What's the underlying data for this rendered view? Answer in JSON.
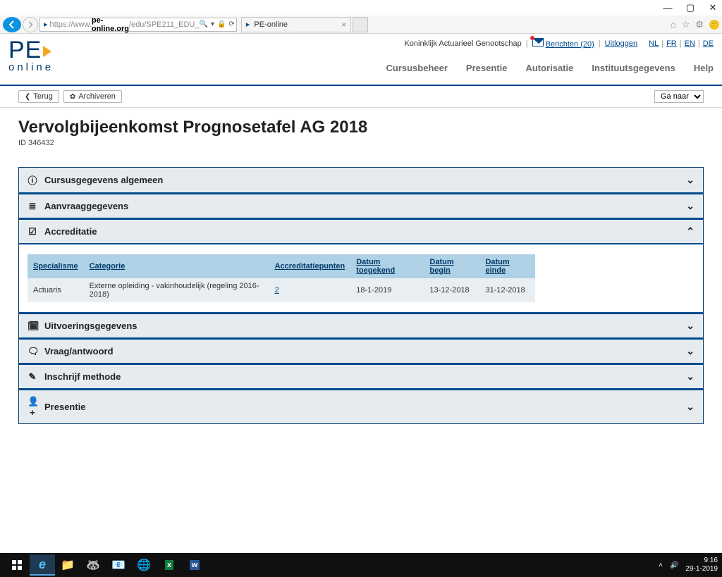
{
  "browser": {
    "url_prefix": "https://",
    "url_pre2": "www.",
    "host": "pe-online.org",
    "url_path": "/edu/SPE211_EDU_",
    "tab_title": "PE-online"
  },
  "header": {
    "organisation": "Koninklijk Actuarieel Genootschap",
    "messages": "Berichten (20)",
    "logout": "Uitloggen",
    "langs": {
      "nl": "NL",
      "fr": "FR",
      "en": "EN",
      "de": "DE"
    }
  },
  "nav": {
    "cursusbeheer": "Cursusbeheer",
    "presentie": "Presentie",
    "autorisatie": "Autorisatie",
    "instituut": "Instituutsgegevens",
    "help": "Help"
  },
  "actions": {
    "terug": "Terug",
    "archiveren": "Archiveren",
    "ganaar": "Ga naar"
  },
  "page": {
    "title": "Vervolgbijeenkomst Prognosetafel AG 2018",
    "id_label": "ID 346432"
  },
  "panels": {
    "cursusgegevens": "Cursusgegevens algemeen",
    "aanvraaggegevens": "Aanvraaggegevens",
    "accreditatie": "Accreditatie",
    "uitvoeringsgegevens": "Uitvoeringsgegevens",
    "vraagantwoord": "Vraag/antwoord",
    "inschrijf": "Inschrijf methode",
    "presentie": "Presentie"
  },
  "accreditation": {
    "headers": {
      "specialisme": "Specialisme",
      "categorie": "Categorie",
      "punten": "Accreditatiepunten",
      "toegekend": "Datum toegekend",
      "begin": "Datum begin",
      "einde": "Datum einde"
    },
    "row": {
      "specialisme": "Actuaris",
      "categorie": "Externe opleiding - vakinhoudelijk (regeling 2016-2018)",
      "punten": "2",
      "toegekend": "18-1-2019",
      "begin": "13-12-2018",
      "einde": "31-12-2018"
    }
  },
  "taskbar": {
    "time": "9:16",
    "date": "29-1-2019"
  }
}
